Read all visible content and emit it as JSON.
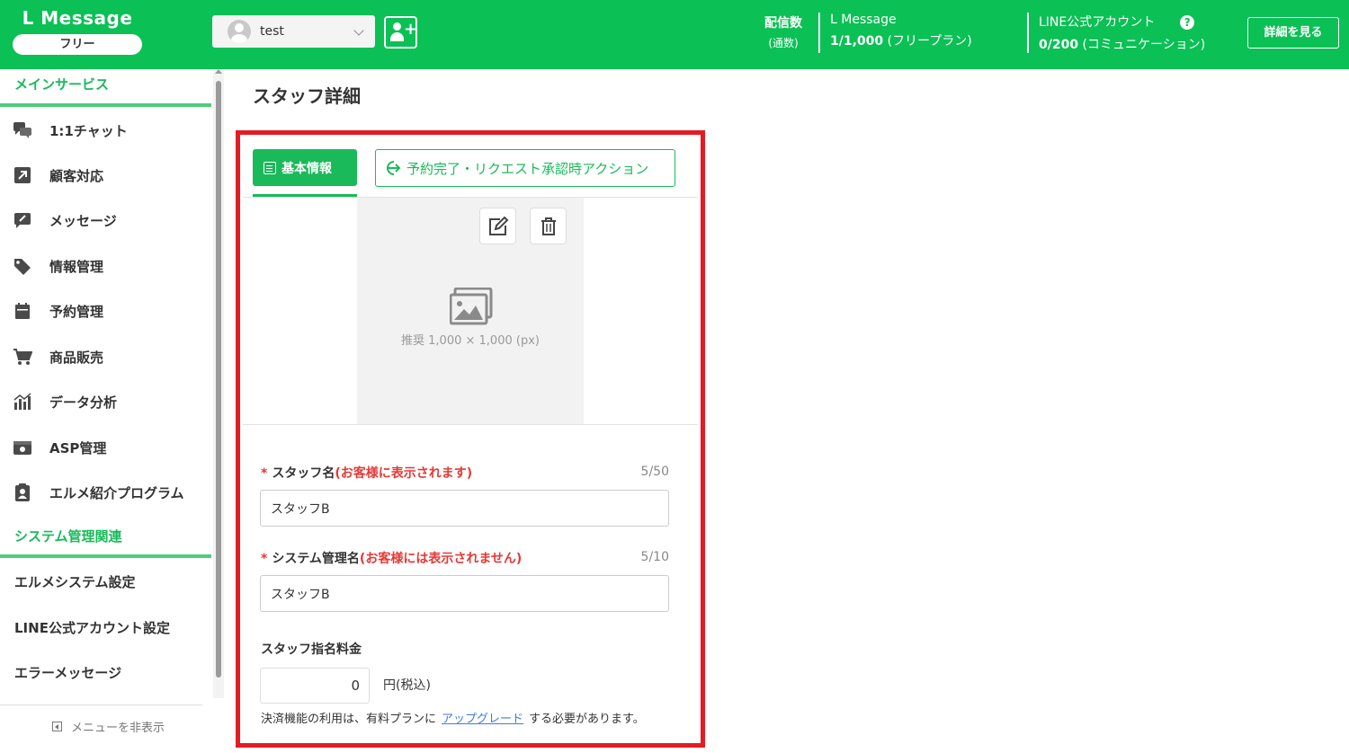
{
  "header": {
    "app_title": "L Message",
    "plan_badge": "フリー",
    "account_name": "test",
    "stats_label_main": "配信数",
    "stats_label_sub": "(通数)",
    "lmessage_label": "L Message",
    "lmessage_count": "1/1,000",
    "lmessage_plan": " (フリープラン)",
    "line_label": "LINE公式アカウント",
    "line_count": "0/200",
    "line_plan": " (コミュニケーション)",
    "help_glyph": "?",
    "detail_button": "詳細を見る"
  },
  "sidebar": {
    "section_main": "メインサービス",
    "items": [
      {
        "label": "1:1チャット",
        "icon": "chat-icon"
      },
      {
        "label": "顧客対応",
        "icon": "external-arrow-icon"
      },
      {
        "label": "メッセージ",
        "icon": "message-edit-icon"
      },
      {
        "label": "情報管理",
        "icon": "tag-icon"
      },
      {
        "label": "予約管理",
        "icon": "calendar-icon"
      },
      {
        "label": "商品販売",
        "icon": "cart-icon"
      },
      {
        "label": "データ分析",
        "icon": "bar-chart-icon"
      },
      {
        "label": "ASP管理",
        "icon": "asp-icon"
      },
      {
        "label": "エルメ紹介プログラム",
        "icon": "clipboard-user-icon"
      }
    ],
    "section_system": "システム管理関連",
    "system_items": [
      "エルメシステム設定",
      "LINE公式アカウント設定",
      "エラーメッセージ"
    ],
    "hide_menu": "メニューを非表示"
  },
  "main": {
    "page_title": "スタッフ詳細",
    "tab_basic": "基本情報",
    "tab_action": "予約完了・リクエスト承認時アクション",
    "image_hint": "推奨 1,000 × 1,000 (px)",
    "staff_name": {
      "required": "*",
      "label": "スタッフ名",
      "note": "(お客様に表示されます)",
      "counter": "5/50",
      "value": "スタッフB"
    },
    "system_name": {
      "required": "*",
      "label": "システム管理名",
      "note": "(お客様には表示されません)",
      "counter": "5/10",
      "value": "スタッフB"
    },
    "fee": {
      "label": "スタッフ指名料金",
      "value": "0",
      "unit": "円(税込)",
      "notice_before": "決済機能の利用は、有料プランに",
      "notice_link": "アップグレード",
      "notice_after": "する必要があります。"
    }
  },
  "colors": {
    "brand_green": "#0bc055",
    "highlight_red": "#e21c23",
    "required_red": "#e53935",
    "link_blue": "#3b7ddd"
  }
}
